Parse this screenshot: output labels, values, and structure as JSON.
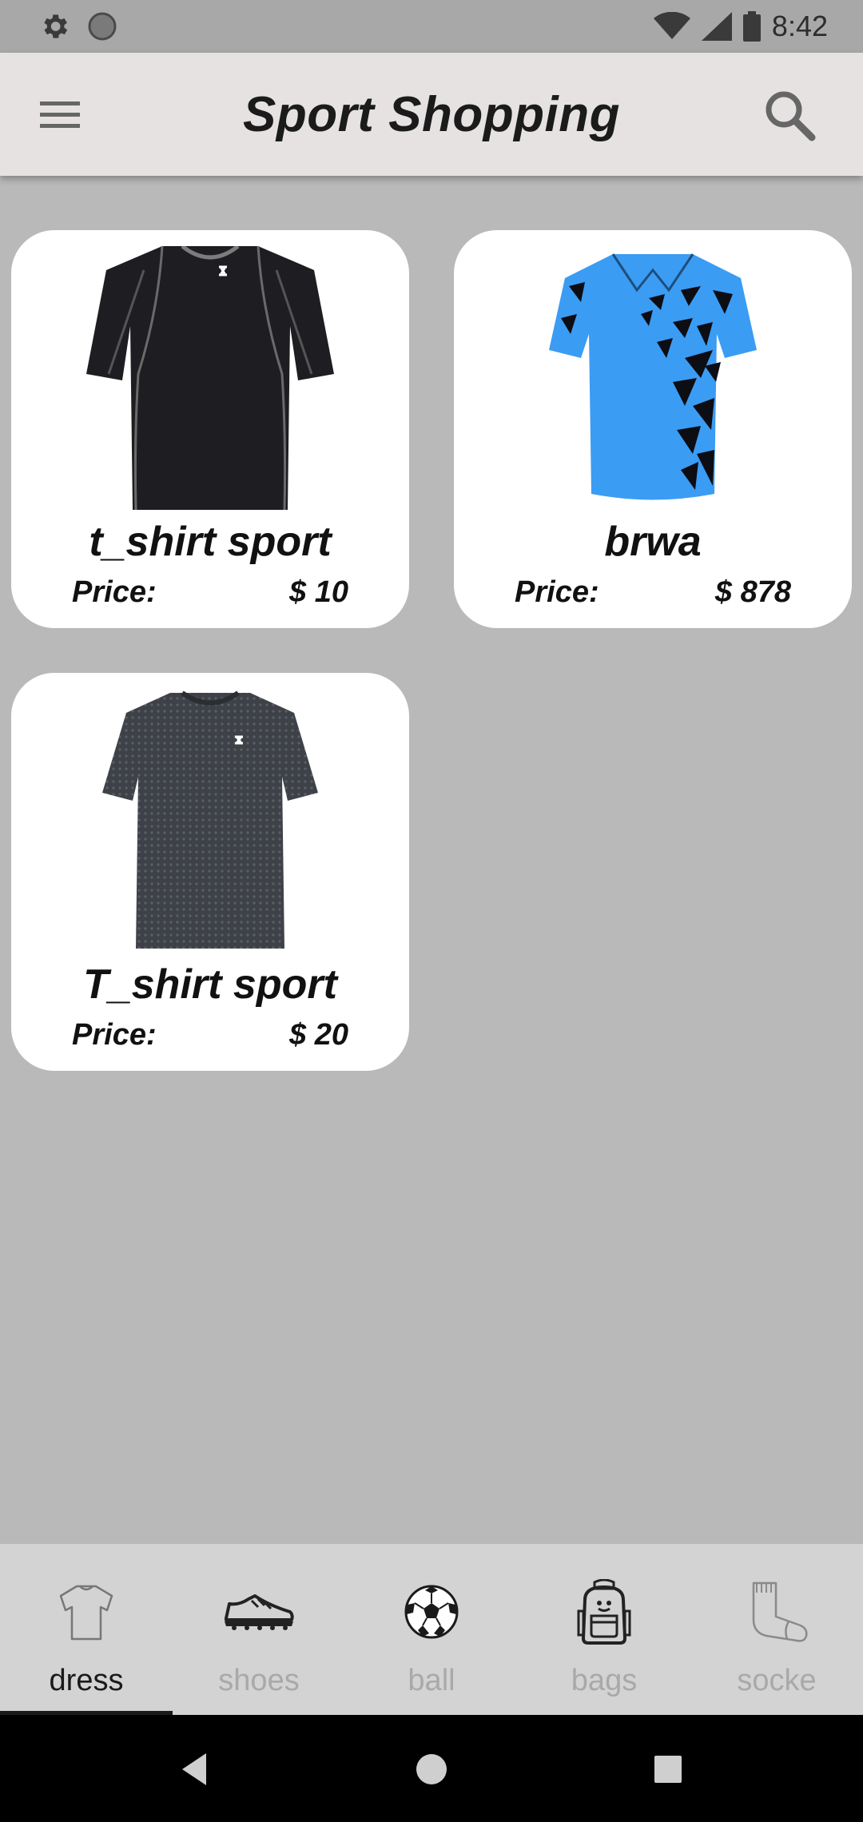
{
  "status_bar": {
    "time": "8:42",
    "icons": [
      "settings-icon",
      "loading-icon",
      "wifi-icon",
      "signal-icon",
      "battery-icon"
    ]
  },
  "app_bar": {
    "title": "Sport Shopping",
    "menu_icon": "menu-icon",
    "search_icon": "search-icon"
  },
  "products": [
    {
      "name": "t_shirt sport",
      "price_label": "Price:",
      "price": "$ 10",
      "image": "black-compression-tshirt"
    },
    {
      "name": "brwa",
      "price_label": "Price:",
      "price": "$ 878",
      "image": "blue-polo-shirt"
    },
    {
      "name": "T_shirt sport",
      "price_label": "Price:",
      "price": "$ 20",
      "image": "gray-tshirt"
    }
  ],
  "bottom_nav": {
    "items": [
      {
        "label": "dress",
        "icon": "tshirt-icon",
        "active": true
      },
      {
        "label": "shoes",
        "icon": "sneaker-icon",
        "active": false
      },
      {
        "label": "ball",
        "icon": "soccer-ball-icon",
        "active": false
      },
      {
        "label": "bags",
        "icon": "backpack-icon",
        "active": false
      },
      {
        "label": "socke",
        "icon": "sock-icon",
        "active": false
      }
    ]
  },
  "system_nav": [
    "back-icon",
    "home-icon",
    "recents-icon"
  ],
  "colors": {
    "background": "#b9b9b9",
    "app_bar": "#e6e2e2",
    "card": "#ffffff",
    "nav_active": "#1a1a1a",
    "nav_inactive": "#a9a9a9"
  }
}
